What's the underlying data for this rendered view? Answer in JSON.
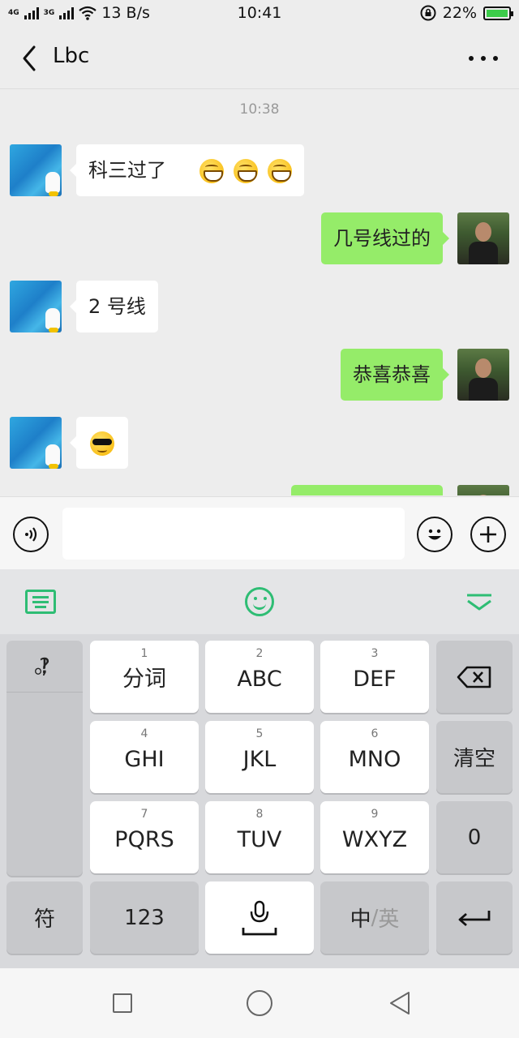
{
  "status_bar": {
    "net1": "4G",
    "net2": "3G",
    "speed": "13 B/s",
    "time": "10:41",
    "battery": "22%"
  },
  "header": {
    "title": "Lbc"
  },
  "chat": {
    "timestamp": "10:38",
    "messages": [
      {
        "side": "in",
        "text": "科三过了",
        "emoji": [
          "grinning-emoji",
          "grinning-emoji",
          "grinning-emoji"
        ]
      },
      {
        "side": "out",
        "text": "几号线过的"
      },
      {
        "side": "in",
        "text": "2 号线"
      },
      {
        "side": "out",
        "text": "恭喜恭喜"
      },
      {
        "side": "in",
        "text": "",
        "emoji": [
          "sunglasses-emoji"
        ]
      }
    ]
  },
  "keyboard": {
    "punct": [
      ",",
      "。",
      "?",
      "!"
    ],
    "row1": [
      {
        "num": "1",
        "label": "分词"
      },
      {
        "num": "2",
        "label": "ABC"
      },
      {
        "num": "3",
        "label": "DEF"
      }
    ],
    "row2": [
      {
        "num": "4",
        "label": "GHI"
      },
      {
        "num": "5",
        "label": "JKL"
      },
      {
        "num": "6",
        "label": "MNO"
      }
    ],
    "row3": [
      {
        "num": "7",
        "label": "PQRS"
      },
      {
        "num": "8",
        "label": "TUV"
      },
      {
        "num": "9",
        "label": "WXYZ"
      }
    ],
    "clear": "清空",
    "zero": "0",
    "symbols": "符",
    "numbers": "123",
    "lang_zh": "中",
    "lang_sep": "/",
    "lang_en": "英"
  },
  "colors": {
    "accent_green": "#2ebd74",
    "outgoing_bubble": "#95ec69",
    "incoming_bubble": "#ffffff"
  },
  "icons": {
    "back": "chevron-left-icon",
    "more": "more-dots-icon",
    "voice": "voice-icon",
    "emoji": "smiley-icon",
    "plus": "plus-icon",
    "keyboard": "keyboard-icon",
    "hide": "chevron-down-icon",
    "backspace": "backspace-icon",
    "mic": "microphone-icon",
    "enter": "enter-icon"
  }
}
